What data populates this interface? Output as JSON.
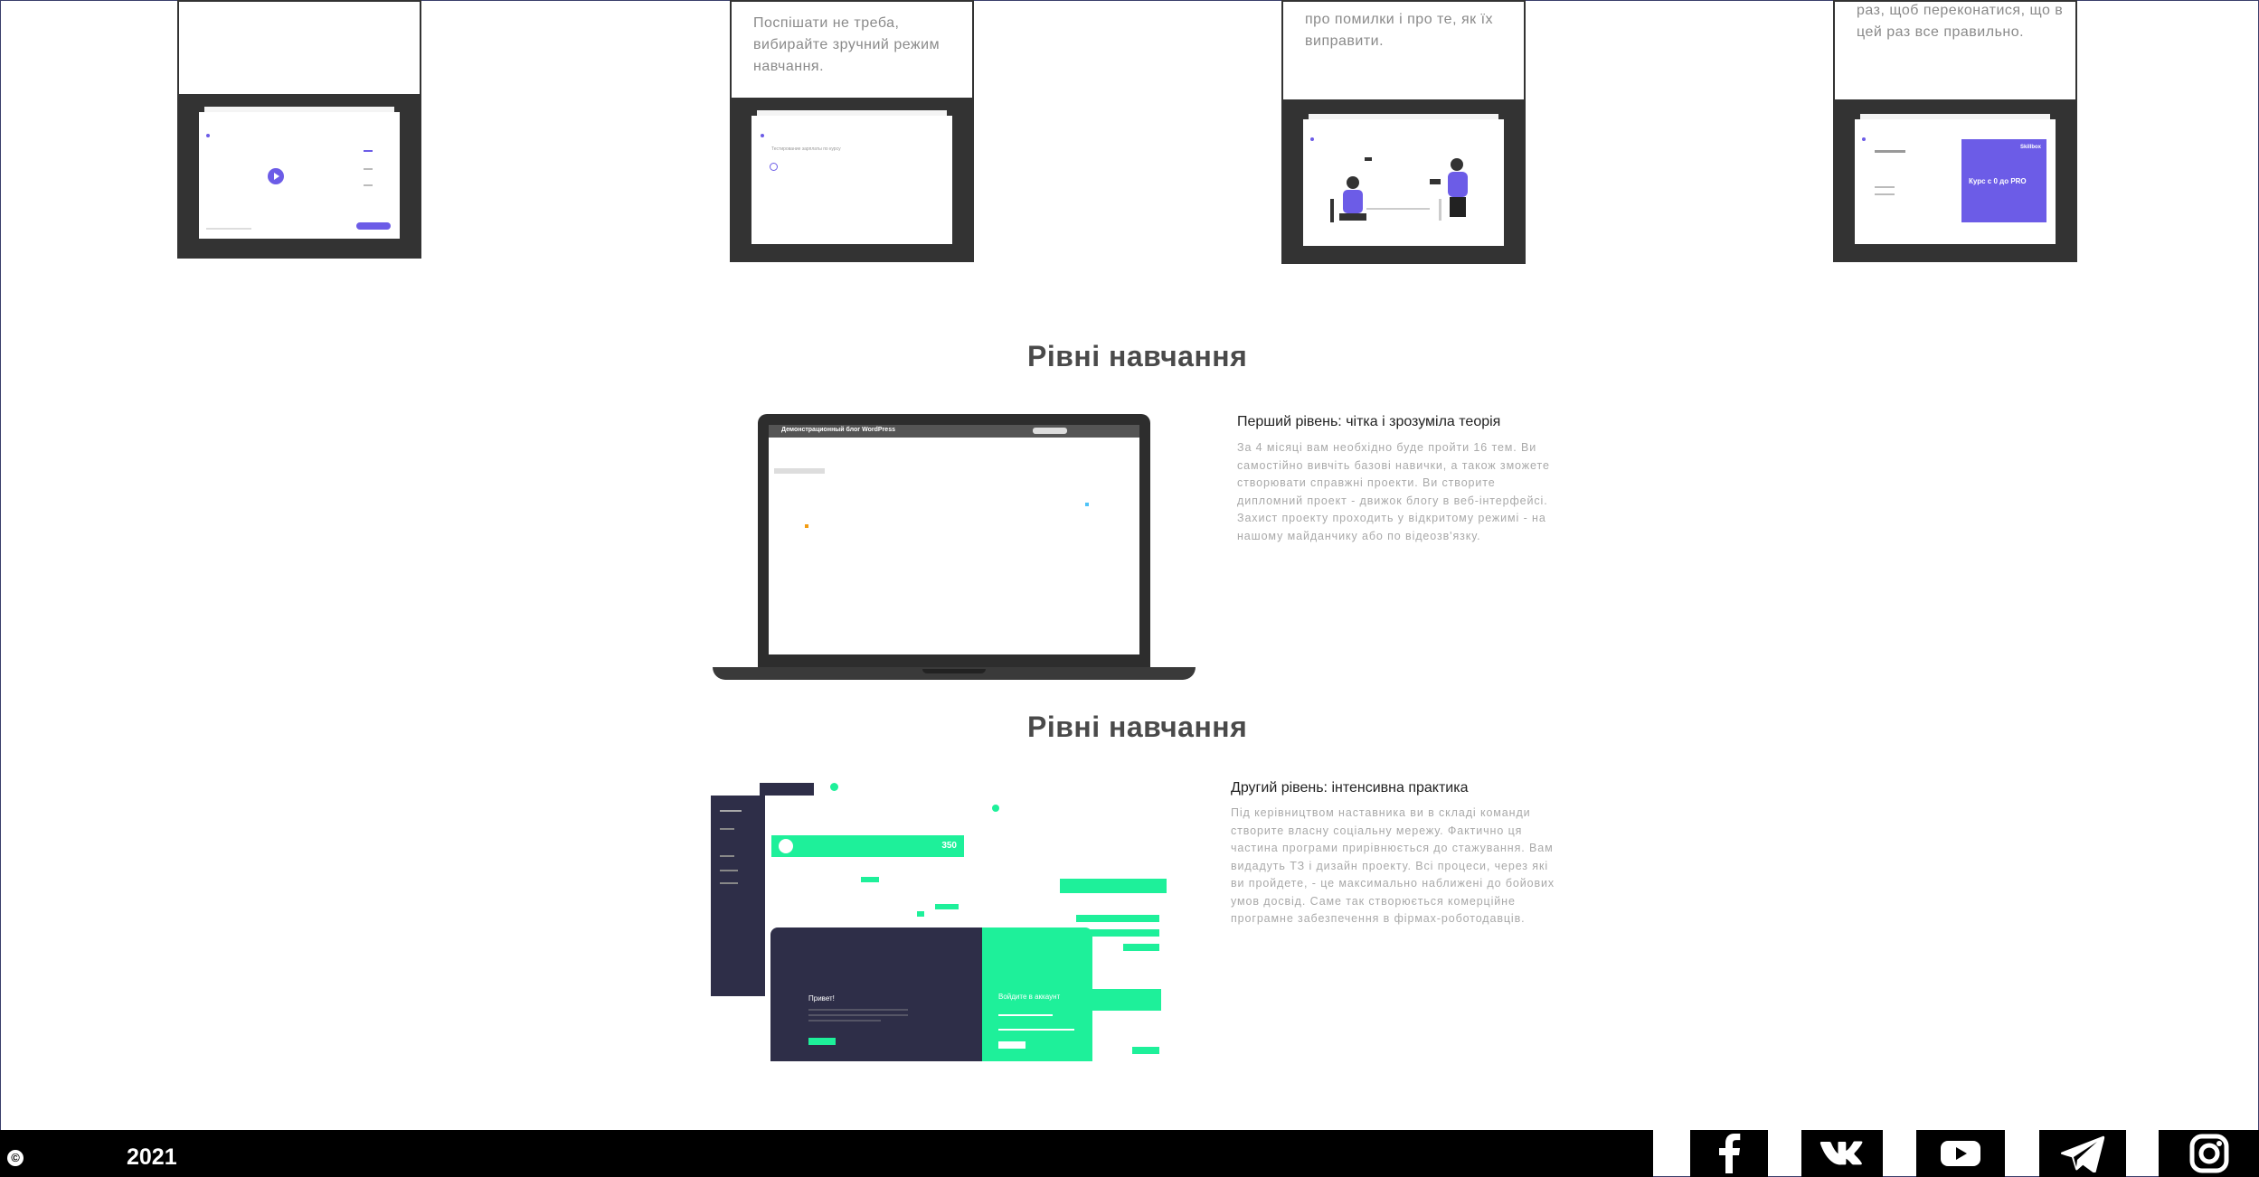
{
  "cards": [
    {
      "text": ""
    },
    {
      "text": "Поспішати не треба, вибирайте зручний режим навчання."
    },
    {
      "text": "про помилки і про те, як їх виправити."
    },
    {
      "text": "раз, щоб переконатися, що в цей раз все правильно."
    }
  ],
  "card_mock": {
    "course_label": "Курс с 0 до PRO",
    "brand": "Skillbox",
    "test_label": "Тестирование зарплаты по курсу"
  },
  "levels": [
    {
      "section_title": "Рівні навчання",
      "heading": "Перший рівень: чітка і зрозуміла теорія",
      "body": "За 4 місяці вам необхідно буде пройти 16 тем. Ви самостійно вивчіть базові навички, а також зможете створювати справжні проекти. Ви створите дипломний проект - движок блогу в веб-інтерфейсі. Захист проекту проходить у відкритому режимі - на нашому майданчику або по відеозв'язку.",
      "mock_title": "Демонстрационный блог WordPress"
    },
    {
      "section_title": "Рівні навчання",
      "heading": "Другий рівень: інтенсивна практика",
      "body": "Під керівництвом наставника ви в складі команди створите власну соціальну мережу. Фактично ця частина програми прирівнюється до стажування. Вам видадуть ТЗ і дизайн проекту. Всі процеси, через які ви пройдете, - це максимально наближені до бойових умов досвід. Саме так створюється комерційне програмне забезпечення в фірмах-роботодавців.",
      "mock_greeting": "Привет!",
      "mock_login": "Войдите в аккаунт",
      "mock_count": "350"
    }
  ],
  "footer": {
    "copyright_symbol": "©",
    "year": "2021",
    "social": [
      "facebook-icon",
      "vk-icon",
      "youtube-icon",
      "telegram-icon",
      "instagram-icon"
    ]
  },
  "colors": {
    "accent_purple": "#6c5ce7",
    "accent_green": "#1ef09a",
    "dark_panel": "#2e2e48",
    "footer_bg": "#000000"
  }
}
